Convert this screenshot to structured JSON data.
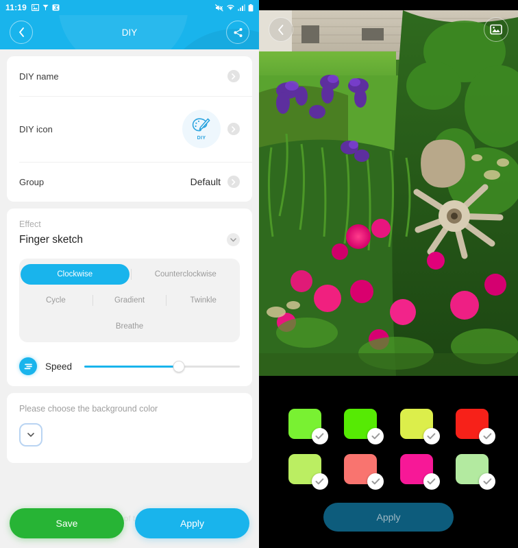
{
  "left": {
    "status_bar": {
      "time": "11:19",
      "left_icons": [
        "image-icon",
        "tether-icon",
        "app-badge-icon"
      ],
      "right_icons": [
        "mute-icon",
        "wifi-icon",
        "signal-icon",
        "battery-icon"
      ]
    },
    "header": {
      "title": "DIY",
      "back_label": "Back",
      "share_label": "Share"
    },
    "info_card": {
      "rows": [
        {
          "label": "DIY name",
          "value": ""
        },
        {
          "label": "DIY icon",
          "value": "",
          "badge_text": "DIY"
        },
        {
          "label": "Group",
          "value": "Default"
        }
      ]
    },
    "effect_card": {
      "section_label": "Effect",
      "effect_name": "Finger sketch",
      "modes_row1": [
        "Clockwise",
        "Counterclockwise"
      ],
      "modes_row2": [
        "Cycle",
        "Gradient",
        "Twinkle"
      ],
      "modes_row3": [
        "Breathe"
      ],
      "active_mode": "Clockwise",
      "speed_label": "Speed",
      "speed_percent": 61,
      "accent_color": "#19b4ec"
    },
    "background_card": {
      "title": "Please choose the background color",
      "swatch_label": "choose-background-color"
    },
    "ghost_text": "of t",
    "actions": {
      "save_label": "Save",
      "apply_label": "Apply",
      "save_color": "#27b435",
      "apply_color": "#19b4ec"
    }
  },
  "right": {
    "header": {
      "back_label": "Back",
      "gallery_label": "Pick image"
    },
    "photo": {
      "description": "Garden with purple irises, pink peonies and an old wooden wagon wheel against a house wall"
    },
    "swatches": [
      {
        "name": "swatch-1",
        "color": "#79f132",
        "selected": true
      },
      {
        "name": "swatch-2",
        "color": "#56ea04",
        "selected": true
      },
      {
        "name": "swatch-3",
        "color": "#dcee4b",
        "selected": true
      },
      {
        "name": "swatch-4",
        "color": "#f72119",
        "selected": true
      },
      {
        "name": "swatch-5",
        "color": "#bbee62",
        "selected": true
      },
      {
        "name": "swatch-6",
        "color": "#f9746f",
        "selected": true
      },
      {
        "name": "swatch-7",
        "color": "#f71897",
        "selected": true
      },
      {
        "name": "swatch-8",
        "color": "#b3eaa0",
        "selected": true
      }
    ],
    "apply": {
      "label": "Apply",
      "enabled": false,
      "color": "#0d5c7c"
    }
  }
}
